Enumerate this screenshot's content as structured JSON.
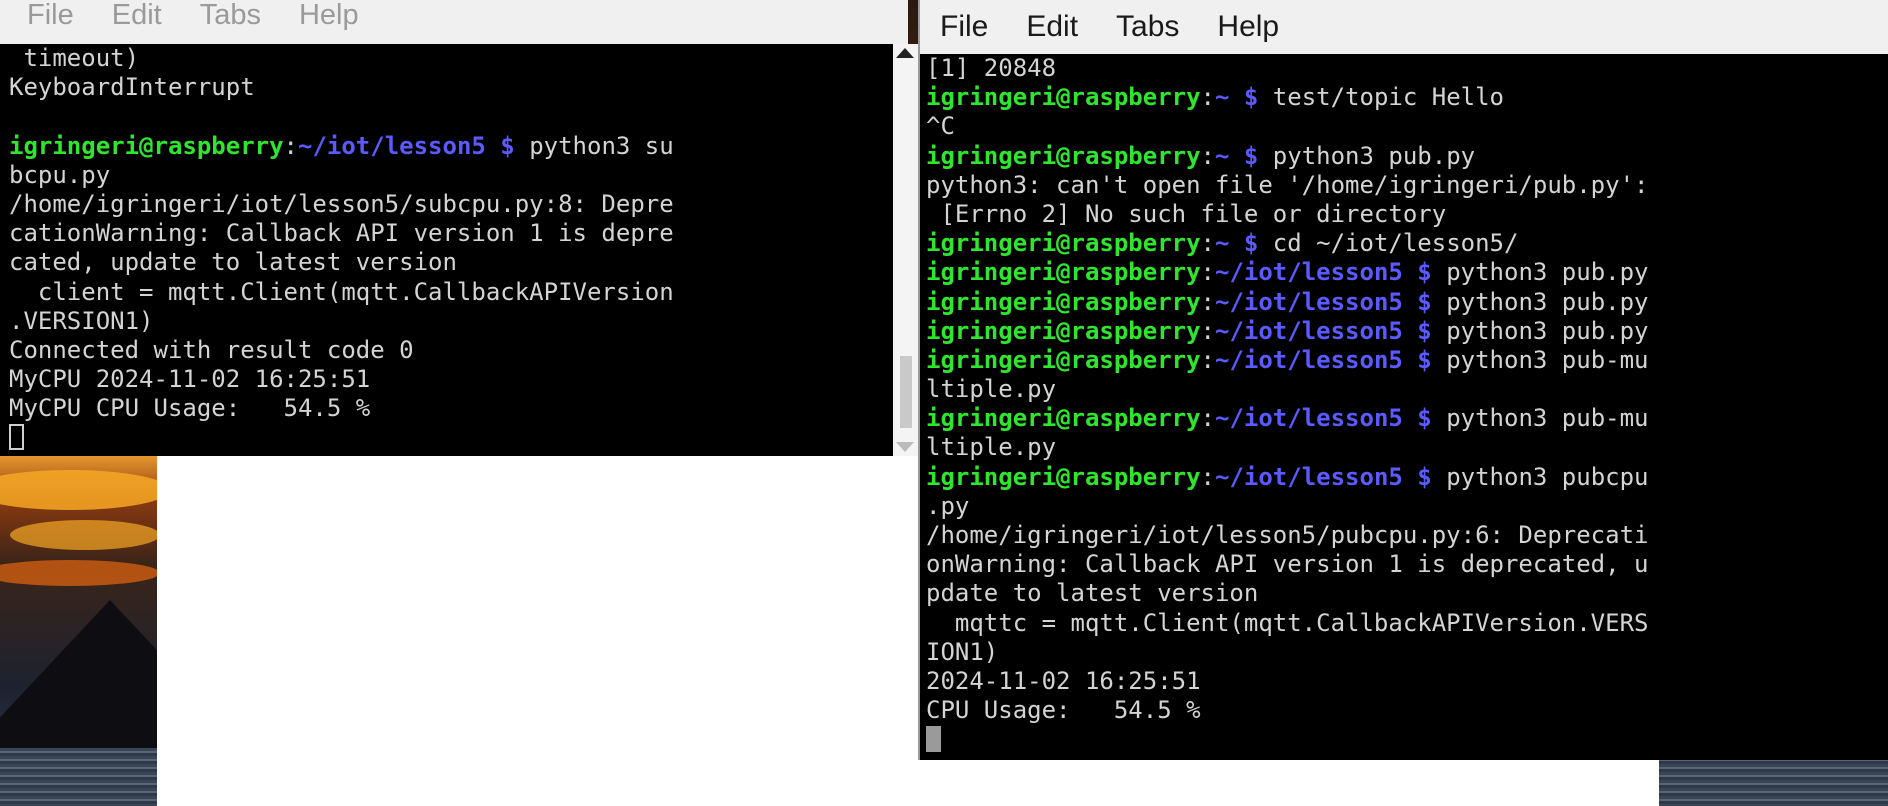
{
  "left_terminal": {
    "menu": [
      "File",
      "Edit",
      "Tabs",
      "Help"
    ],
    "lines": [
      {
        "text": " timeout)"
      },
      {
        "text": "KeyboardInterrupt"
      },
      {
        "text": ""
      },
      {
        "user": "igringeri@raspberry",
        "sep": ":",
        "path": "~/iot/lesson5 $",
        "cmd": " python3 su"
      },
      {
        "text": "bcpu.py"
      },
      {
        "text": "/home/igringeri/iot/lesson5/subcpu.py:8: Depre"
      },
      {
        "text": "cationWarning: Callback API version 1 is depre"
      },
      {
        "text": "cated, update to latest version"
      },
      {
        "text": "  client = mqtt.Client(mqtt.CallbackAPIVersion"
      },
      {
        "text": ".VERSION1)"
      },
      {
        "text": "Connected with result code 0"
      },
      {
        "text": "MyCPU 2024-11-02 16:25:51"
      },
      {
        "text": "MyCPU CPU Usage:   54.5 %"
      }
    ]
  },
  "right_terminal": {
    "menu": [
      "File",
      "Edit",
      "Tabs",
      "Help"
    ],
    "lines": [
      {
        "text": "[1] 20848"
      },
      {
        "user": "igringeri@raspberry",
        "sep": ":",
        "path": "~ $",
        "cmd": " test/topic Hello"
      },
      {
        "text": "^C"
      },
      {
        "user": "igringeri@raspberry",
        "sep": ":",
        "path": "~ $",
        "cmd": " python3 pub.py"
      },
      {
        "text": "python3: can't open file '/home/igringeri/pub.py':"
      },
      {
        "text": " [Errno 2] No such file or directory"
      },
      {
        "user": "igringeri@raspberry",
        "sep": ":",
        "path": "~ $",
        "cmd": " cd ~/iot/lesson5/"
      },
      {
        "user": "igringeri@raspberry",
        "sep": ":",
        "path": "~/iot/lesson5 $",
        "cmd": " python3 pub.py"
      },
      {
        "user": "igringeri@raspberry",
        "sep": ":",
        "path": "~/iot/lesson5 $",
        "cmd": " python3 pub.py"
      },
      {
        "user": "igringeri@raspberry",
        "sep": ":",
        "path": "~/iot/lesson5 $",
        "cmd": " python3 pub.py"
      },
      {
        "user": "igringeri@raspberry",
        "sep": ":",
        "path": "~/iot/lesson5 $",
        "cmd": " python3 pub-mu"
      },
      {
        "text": "ltiple.py"
      },
      {
        "user": "igringeri@raspberry",
        "sep": ":",
        "path": "~/iot/lesson5 $",
        "cmd": " python3 pub-mu"
      },
      {
        "text": "ltiple.py"
      },
      {
        "user": "igringeri@raspberry",
        "sep": ":",
        "path": "~/iot/lesson5 $",
        "cmd": " python3 pubcpu"
      },
      {
        "text": ".py"
      },
      {
        "text": "/home/igringeri/iot/lesson5/pubcpu.py:6: Deprecati"
      },
      {
        "text": "onWarning: Callback API version 1 is deprecated, u"
      },
      {
        "text": "pdate to latest version"
      },
      {
        "text": "  mqttc = mqtt.Client(mqtt.CallbackAPIVersion.VERS"
      },
      {
        "text": "ION1)"
      },
      {
        "text": "2024-11-02 16:25:51"
      },
      {
        "text": "CPU Usage:   54.5 %"
      }
    ]
  }
}
